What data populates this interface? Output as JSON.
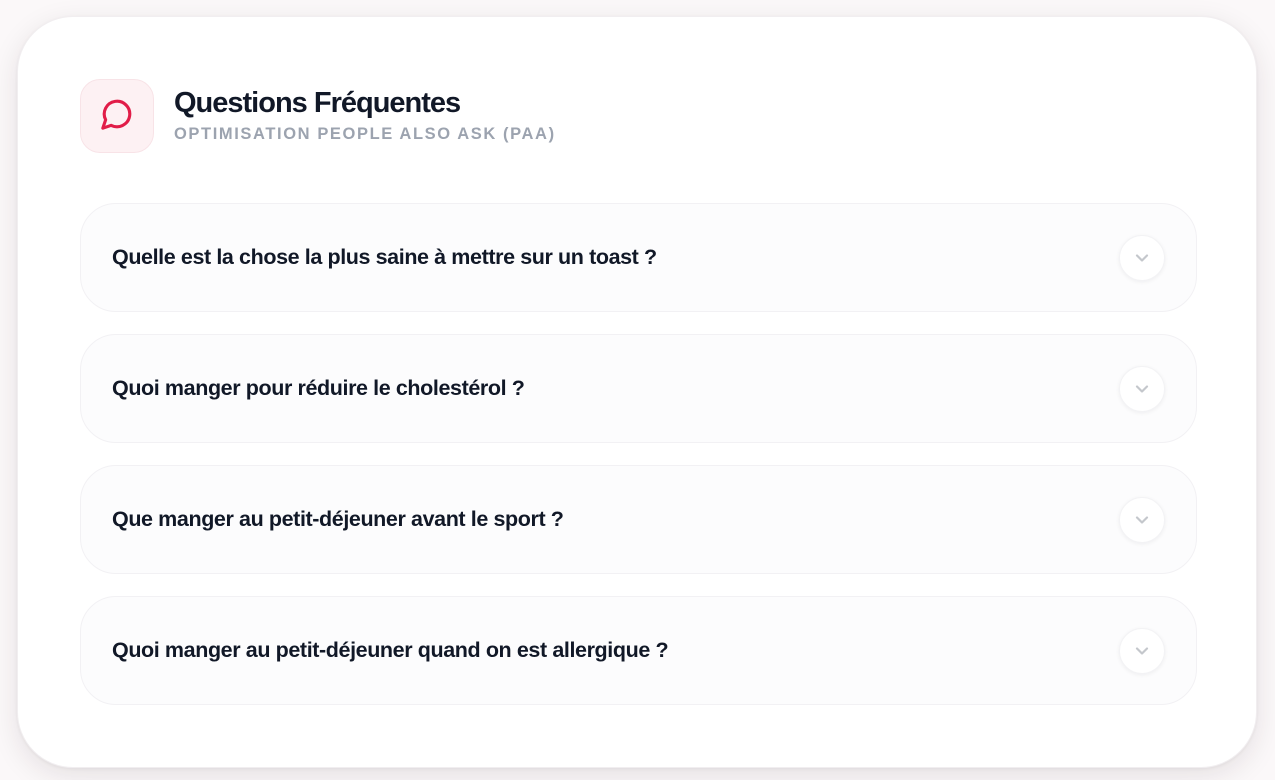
{
  "header": {
    "icon": "chat-bubble-icon",
    "title": "Questions Fréquentes",
    "subtitle": "OPTIMISATION PEOPLE ALSO ASK (PAA)"
  },
  "faq": {
    "items": [
      {
        "question": "Quelle est la chose la plus saine à mettre sur un toast ?",
        "icon": "chevron-down-icon"
      },
      {
        "question": "Quoi manger pour réduire le cholestérol ?",
        "icon": "chevron-down-icon"
      },
      {
        "question": "Que manger au petit-déjeuner avant le sport ?",
        "icon": "chevron-down-icon"
      },
      {
        "question": "Quoi manger au petit-déjeuner quand on est allergique ?",
        "icon": "chevron-down-icon"
      }
    ]
  },
  "colors": {
    "accent": "#e11d48",
    "title": "#111827",
    "subtitle": "#9ca3af",
    "chevron": "#c4c7cc"
  }
}
